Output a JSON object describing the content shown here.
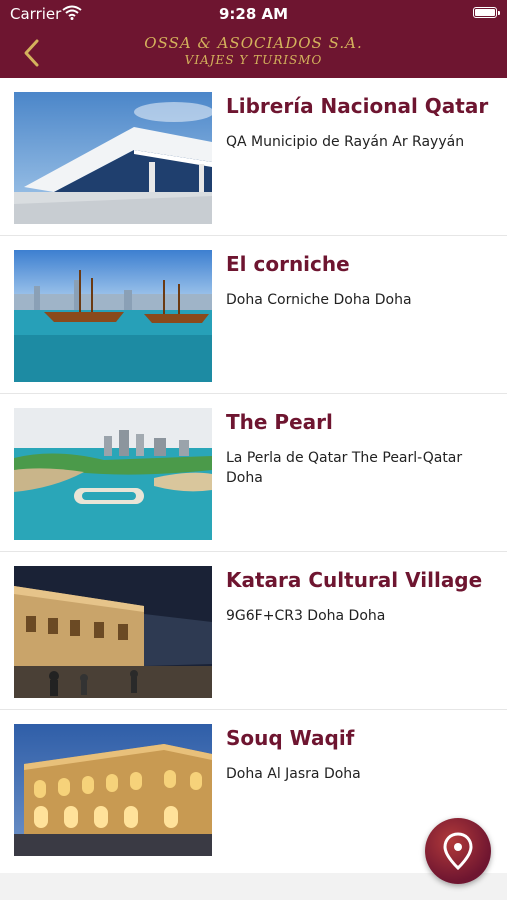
{
  "status_bar": {
    "carrier": "Carrier",
    "time": "9:28 AM"
  },
  "header": {
    "brand_line1": "OSSA & ASOCIADOS S.A.",
    "brand_line2": "VIAJES Y TURISMO"
  },
  "places": [
    {
      "title": "Librería Nacional Qatar",
      "address": "QA Municipio de Rayán Ar Rayyán",
      "image": "library-building"
    },
    {
      "title": "El corniche",
      "address": "Doha Corniche Doha Doha",
      "image": "dhow-boats-skyline"
    },
    {
      "title": "The Pearl",
      "address": "La Perla de Qatar The Pearl-Qatar Doha",
      "image": "pearl-island-marina"
    },
    {
      "title": "Katara Cultural Village",
      "address": "9G6F+CR3 Doha Doha",
      "image": "katara-night-street"
    },
    {
      "title": "Souq Waqif",
      "address": "Doha Al Jasra Doha",
      "image": "souq-waqif-building"
    }
  ],
  "colors": {
    "brand": "#6e1530",
    "gold": "#d4b25c"
  }
}
